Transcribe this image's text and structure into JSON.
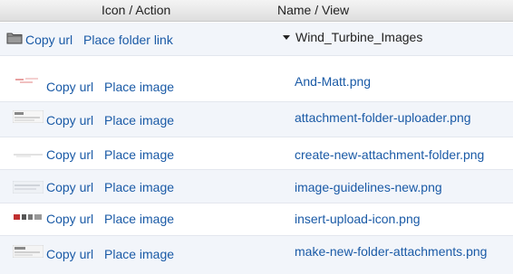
{
  "header": {
    "action_col": "Icon / Action",
    "name_col": "Name / View"
  },
  "folder": {
    "copy_url": "Copy url",
    "place_link": "Place folder link",
    "name": "Wind_Turbine_Images",
    "icon": "folder-icon"
  },
  "files": [
    {
      "copy_url": "Copy url",
      "place": "Place image",
      "name": "And-Matt.png"
    },
    {
      "copy_url": "Copy url",
      "place": "Place image",
      "name": "attachment-folder-uploader.png"
    },
    {
      "copy_url": "Copy url",
      "place": "Place image",
      "name": "create-new-attachment-folder.png"
    },
    {
      "copy_url": "Copy url",
      "place": "Place image",
      "name": "image-guidelines-new.png"
    },
    {
      "copy_url": "Copy url",
      "place": "Place image",
      "name": "insert-upload-icon.png"
    },
    {
      "copy_url": "Copy url",
      "place": "Place image",
      "name": "make-new-folder-attachments.png"
    }
  ],
  "colors": {
    "link": "#1a5aa6",
    "alt_row": "#f2f5fa",
    "header_bg": "#e6e6e6"
  }
}
